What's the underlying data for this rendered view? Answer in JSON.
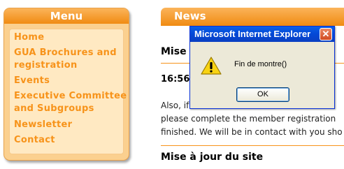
{
  "menu": {
    "title": "Menu",
    "items": [
      {
        "label": "Home"
      },
      {
        "label": "GUA Brochures and"
      },
      {
        "label": "registration"
      },
      {
        "label": "Events"
      },
      {
        "label": "Executive Committee"
      },
      {
        "label": "and Subgroups"
      },
      {
        "label": "Newsletter"
      },
      {
        "label": "Contact"
      }
    ]
  },
  "news": {
    "title": "News",
    "item1_title": "Mise à",
    "item1_time": "16:56",
    "body_lines": [
      "Also, if",
      "please complete the member registration",
      "finished. We will be in contact with you sho"
    ],
    "item2_title": "Mise à jour du site"
  },
  "dialog": {
    "title": "Microsoft Internet Explorer",
    "close_glyph": "✕",
    "message": "Fin de montre()",
    "ok_label": "OK",
    "icon": "warning-icon"
  },
  "colors": {
    "accent": "#f7931a",
    "menu_bg": "#fbd08f",
    "dialog_title": "#0348d6"
  }
}
